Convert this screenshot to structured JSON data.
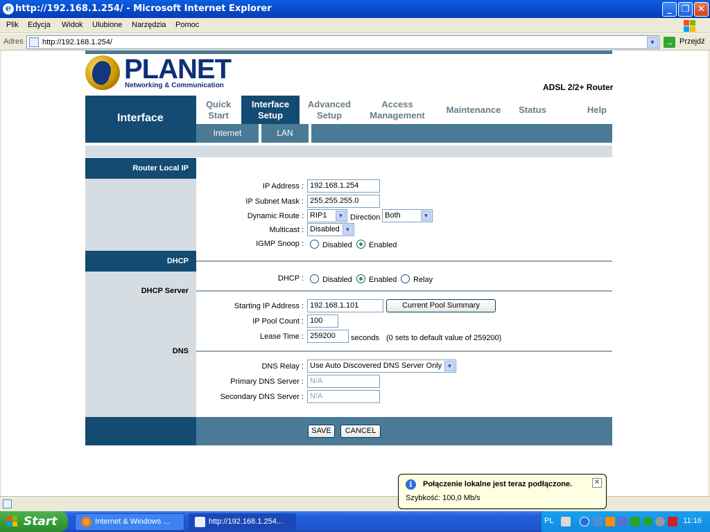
{
  "window": {
    "title": "http://192.168.1.254/ - Microsoft Internet Explorer",
    "min": "_",
    "max": "❐",
    "close": "✕"
  },
  "menu": [
    "Plik",
    "Edycja",
    "Widok",
    "Ulubione",
    "Narzędzia",
    "Pomoc"
  ],
  "address": {
    "label": "Adres",
    "url": "http://192.168.1.254/",
    "go_label": "Przejdź"
  },
  "router": {
    "brand": "PLANET",
    "tagline": "Networking & Communication",
    "product": "ADSL 2/2+ Router",
    "section_title": "Interface",
    "tabs": [
      {
        "l1": "Quick",
        "l2": "Start"
      },
      {
        "l1": "Interface",
        "l2": "Setup"
      },
      {
        "l1": "Advanced",
        "l2": "Setup"
      },
      {
        "l1": "Access",
        "l2": "Management"
      },
      {
        "l1": "Maintenance",
        "l2": ""
      },
      {
        "l1": "Status",
        "l2": ""
      },
      {
        "l1": "Help",
        "l2": ""
      }
    ],
    "subtabs": [
      "Internet",
      "LAN"
    ],
    "sections": {
      "router_local_ip": "Router Local IP",
      "dhcp": "DHCP",
      "dhcp_server": "DHCP Server",
      "dns": "DNS"
    },
    "fields": {
      "ip_address_label": "IP Address :",
      "ip_address": "192.168.1.254",
      "subnet_label": "IP Subnet Mask :",
      "subnet": "255.255.255.0",
      "dynamic_route_label": "Dynamic Route :",
      "dynamic_route": "RIP1",
      "direction_label": "Direction",
      "direction": "Both",
      "multicast_label": "Multicast :",
      "multicast": "Disabled",
      "igmp_label": "IGMP Snoop :",
      "igmp_disabled": "Disabled",
      "igmp_enabled": "Enabled",
      "dhcp_label": "DHCP :",
      "dhcp_disabled": "Disabled",
      "dhcp_enabled": "Enabled",
      "dhcp_relay": "Relay",
      "start_ip_label": "Starting IP Address :",
      "start_ip": "192.168.1.101",
      "pool_summary_btn": "Current Pool Summary",
      "pool_count_label": "IP Pool Count :",
      "pool_count": "100",
      "lease_label": "Lease Time :",
      "lease": "259200",
      "lease_unit": "seconds",
      "lease_note": "(0 sets to default value of 259200)",
      "dns_relay_label": "DNS Relay :",
      "dns_relay": "Use Auto Discovered DNS Server Only",
      "primary_dns_label": "Primary DNS Server :",
      "primary_dns": "N/A",
      "secondary_dns_label": "Secondary DNS Server :",
      "secondary_dns": "N/A"
    },
    "buttons": {
      "save": "SAVE",
      "cancel": "CANCEL"
    }
  },
  "balloon": {
    "title": "Połączenie lokalne jest teraz podłączone.",
    "text": "Szybkość: 100,0 Mb/s"
  },
  "taskbar": {
    "start": "Start",
    "items": [
      "Internet & Windows ...",
      "http://192.168.1.254..."
    ],
    "lang": "PL",
    "clock": "11:16"
  }
}
